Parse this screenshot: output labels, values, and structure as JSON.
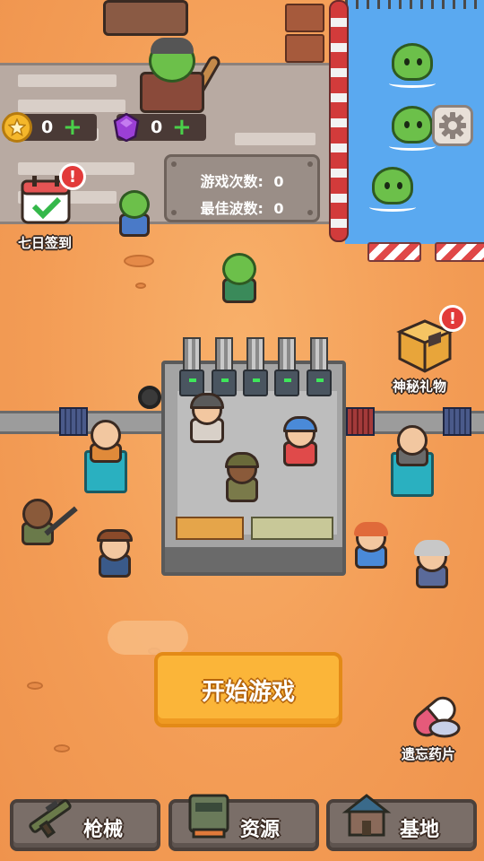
{
  "currency": {
    "coins": "0",
    "gems": "0",
    "coin_plus": "+",
    "gem_plus": "+"
  },
  "stats": {
    "games_played_label": "游戏次数:",
    "games_played_value": "0",
    "best_wave_label": "最佳波数:",
    "best_wave_value": "0"
  },
  "checkin": {
    "label": "七日签到",
    "badge": "!"
  },
  "mystery_gift": {
    "label": "神秘礼物",
    "badge": "!"
  },
  "forget_pill": {
    "label": "遗忘药片"
  },
  "start_button": {
    "label": "开始游戏"
  },
  "bottom_nav": {
    "guns": "枪械",
    "resources": "资源",
    "base": "基地"
  },
  "icons": {
    "coin": "star-coin-icon",
    "gem": "purple-gem-icon",
    "settings": "gear-icon",
    "calendar": "calendar-check-icon",
    "gift": "mystery-box-icon",
    "pill": "pill-icon"
  },
  "colors": {
    "ground": "#f6a35a",
    "start_button": "#fbb539",
    "nav_button": "#7a6e68",
    "zombie_green": "#6cc04a",
    "water": "#5aa9f0",
    "alert_red": "#e23a3a"
  }
}
